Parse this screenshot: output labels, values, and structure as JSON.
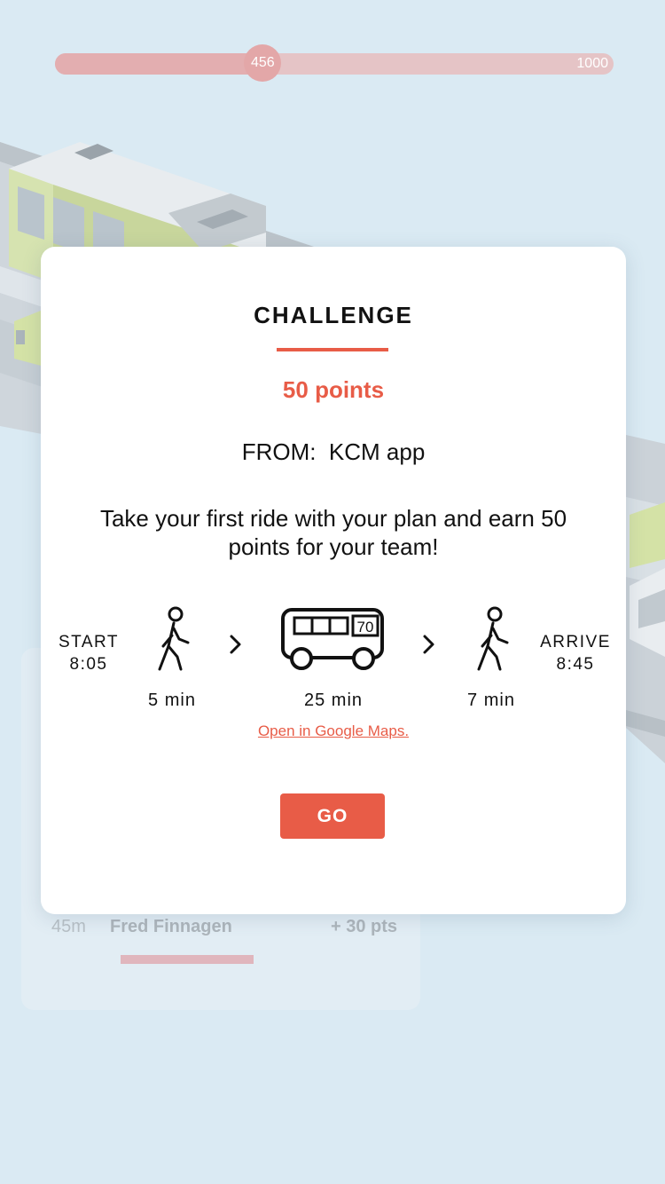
{
  "progress": {
    "value": 456,
    "max": 1000,
    "value_label": "456",
    "max_label": "1000",
    "fraction": 0.372
  },
  "background_card": {
    "row": {
      "time": "45m",
      "name": "Fred Finnagen",
      "points": "+ 30 pts"
    }
  },
  "modal": {
    "title": "CHALLENGE",
    "points": "50 points",
    "from": "FROM:  KCM app",
    "description": "Take your first ride with your plan and earn 50 points for your team!",
    "start": {
      "label": "START",
      "time": "8:05"
    },
    "arrive": {
      "label": "ARRIVE",
      "time": "8:45"
    },
    "steps": {
      "walk1": {
        "duration": "5 min",
        "icon": "walking-person-icon"
      },
      "bus": {
        "duration": "25 min",
        "route": "70",
        "icon": "bus-icon"
      },
      "walk2": {
        "duration": "7 min",
        "icon": "walking-person-icon"
      }
    },
    "maps_link": "Open in Google Maps.",
    "go_label": "GO"
  },
  "colors": {
    "accent": "#e85c47",
    "background": "#daeaf3",
    "progress_track": "#e5c4c6"
  }
}
